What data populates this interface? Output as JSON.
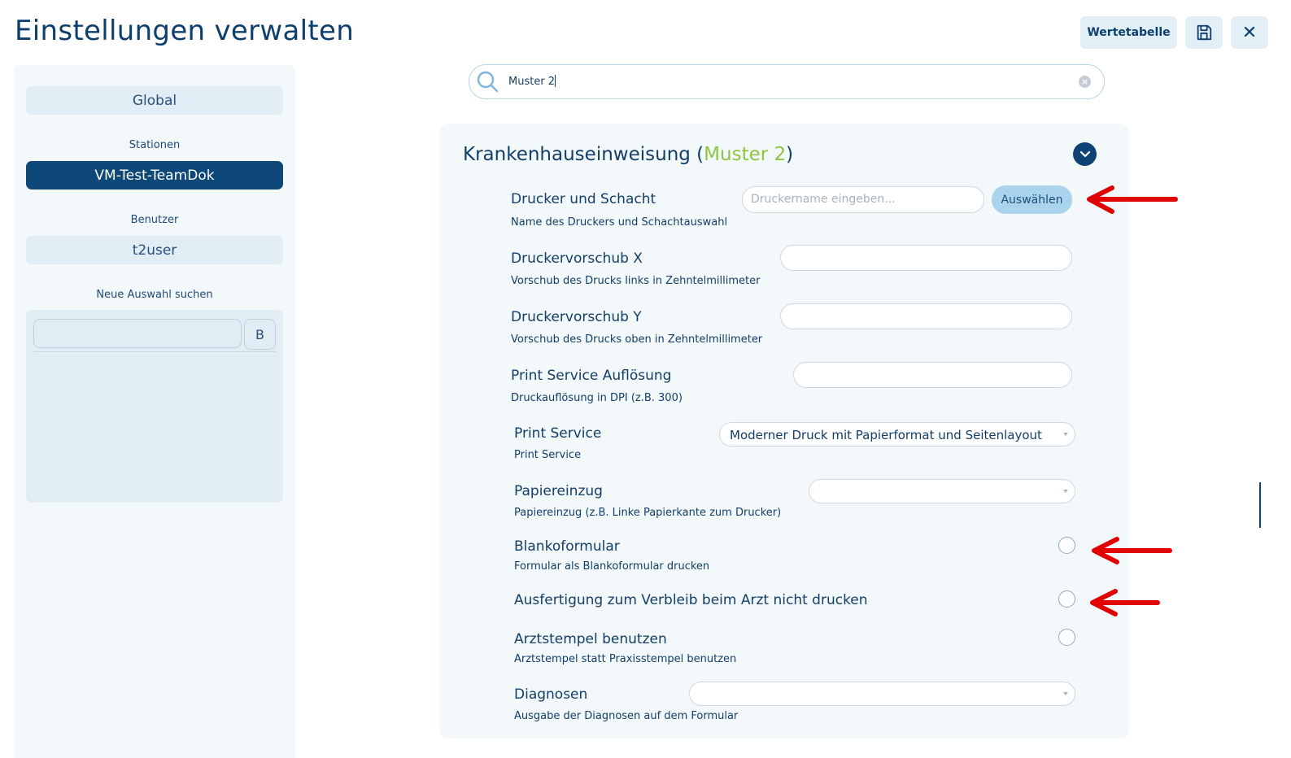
{
  "header": {
    "title": "Einstellungen verwalten",
    "wertetabelle_label": "Wertetabelle",
    "save_icon": "save-icon",
    "close_icon": "close-icon",
    "close_glyph": "✕"
  },
  "sidebar": {
    "global_label": "Global",
    "stationen_heading": "Stationen",
    "station_selected": "VM-Test-TeamDok",
    "benutzer_heading": "Benutzer",
    "benutzer_value": "t2user",
    "neue_auswahl_heading": "Neue Auswahl suchen",
    "search_value": "",
    "search_button_label": "B"
  },
  "search": {
    "value": "Muster 2",
    "clear_glyph": "×"
  },
  "panel": {
    "title_prefix": "Krankenhauseinweisung (",
    "title_accent": "Muster 2",
    "title_suffix": ")",
    "rows": [
      {
        "label": "Drucker und Schacht",
        "desc": "Name des Druckers und Schachtauswahl",
        "placeholder": "Druckername eingeben...",
        "button": "Auswählen"
      },
      {
        "label": "Druckervorschub X",
        "desc": "Vorschub des Drucks links in Zehntelmillimeter",
        "value": ""
      },
      {
        "label": "Druckervorschub Y",
        "desc": "Vorschub des Drucks oben in Zehntelmillimeter",
        "value": ""
      },
      {
        "label": "Print Service Auflösung",
        "desc": "Druckauflösung in DPI (z.B. 300)",
        "value": ""
      },
      {
        "label": "Print Service",
        "desc": "Print Service",
        "value": "Moderner Druck mit Papierformat und Seitenlayout"
      },
      {
        "label": "Papiereinzug",
        "desc": "Papiereinzug (z.B. Linke Papierkante zum Drucker)",
        "value": ""
      },
      {
        "label": "Blankoformular",
        "desc": "Formular als Blankoformular drucken",
        "checked": false
      },
      {
        "label": "Ausfertigung zum Verbleib beim Arzt nicht drucken",
        "checked": false
      },
      {
        "label": "Arztstempel benutzen",
        "desc": "Arztstempel statt Praxisstempel benutzen",
        "checked": false
      },
      {
        "label": "Diagnosen",
        "desc": "Ausgabe der Diagnosen auf dem Formular",
        "value": ""
      }
    ]
  },
  "colors": {
    "primary": "#0d4275",
    "accent_green": "#8cc63f",
    "annotation_red": "#e00000",
    "button_light": "#a9d4ec"
  }
}
